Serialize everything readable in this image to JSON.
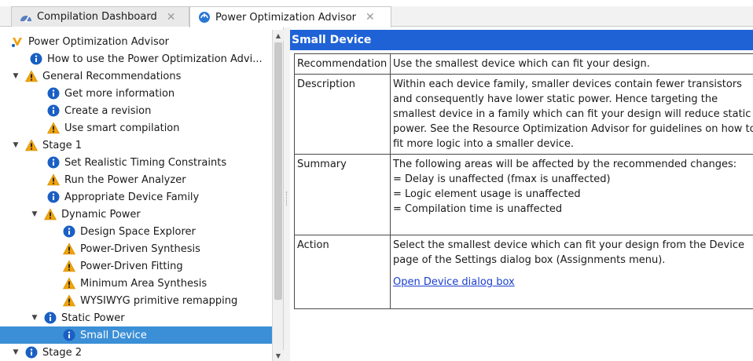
{
  "tabs": [
    {
      "label": "Compilation Dashboard",
      "icon": "dashboard-icon",
      "active": false
    },
    {
      "label": "Power Optimization Advisor",
      "icon": "power-advisor-icon",
      "active": true
    }
  ],
  "tree": {
    "root": "Power Optimization Advisor",
    "items": [
      {
        "label": "How to use the Power Optimization Advi...",
        "icon": "info-icon"
      },
      {
        "label": "General Recommendations",
        "icon": "warning-icon"
      },
      {
        "label": "Get more information",
        "icon": "info-icon"
      },
      {
        "label": "Create a revision",
        "icon": "info-icon"
      },
      {
        "label": "Use smart compilation",
        "icon": "warning-icon"
      },
      {
        "label": "Stage 1",
        "icon": "warning-icon"
      },
      {
        "label": "Set Realistic Timing Constraints",
        "icon": "info-icon"
      },
      {
        "label": "Run the Power Analyzer",
        "icon": "warning-icon"
      },
      {
        "label": "Appropriate Device Family",
        "icon": "info-icon"
      },
      {
        "label": "Dynamic Power",
        "icon": "warning-icon"
      },
      {
        "label": "Design Space Explorer",
        "icon": "info-icon"
      },
      {
        "label": "Power-Driven Synthesis",
        "icon": "warning-icon"
      },
      {
        "label": "Power-Driven Fitting",
        "icon": "warning-icon"
      },
      {
        "label": "Minimum Area Synthesis",
        "icon": "warning-icon"
      },
      {
        "label": "WYSIWYG primitive remapping",
        "icon": "warning-icon"
      },
      {
        "label": "Static Power",
        "icon": "info-icon"
      },
      {
        "label": "Small Device",
        "icon": "info-icon"
      },
      {
        "label": "Stage 2",
        "icon": "info-icon"
      }
    ]
  },
  "panel": {
    "title": "Small Device",
    "rows": {
      "recommendation": {
        "key": "Recommendation",
        "value": "Use the smallest device which can fit your design."
      },
      "description": {
        "key": "Description",
        "value": "Within each device family, smaller devices contain fewer transistors and consequently have lower static power. Hence targeting the smallest device in a family which can fit your design will reduce static power. See the Resource Optimization Advisor for guidelines on how to fit more logic into a smaller device."
      },
      "summary": {
        "key": "Summary",
        "lines": [
          "The following areas will be affected by the recommended changes:",
          "= Delay is unaffected (fmax is unaffected)",
          "= Logic element usage is unaffected",
          "= Compilation time is unaffected"
        ]
      },
      "action": {
        "key": "Action",
        "value": "Select the smallest device which can fit your design from the Device page of the Settings dialog box (Assignments menu).",
        "link": "Open Device dialog box"
      }
    }
  },
  "colors": {
    "header": "#1f62d6",
    "selection": "#3b8fd6",
    "info": "#1a5fc4",
    "warning": "#f0a30a",
    "link": "#1a3fd1"
  }
}
